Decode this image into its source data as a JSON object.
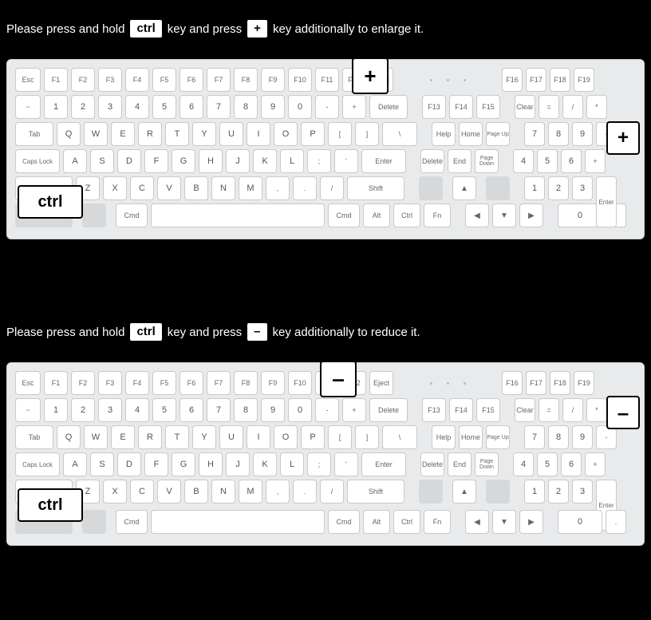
{
  "enlarge": {
    "instruction_pre": "Please press and hold",
    "ctrl_label": "ctrl",
    "instruction_mid": "key and press",
    "op_label": "+",
    "instruction_post": "key additionally to enlarge it.",
    "callout_ctrl": "ctrl",
    "callout_plus_main": "+",
    "callout_plus_num": "+"
  },
  "reduce": {
    "instruction_pre": "Please press and hold",
    "ctrl_label": "ctrl",
    "instruction_mid": "key and press",
    "op_label": "–",
    "instruction_post": "key additionally to reduce it.",
    "callout_ctrl": "ctrl",
    "callout_minus_main": "–",
    "callout_minus_num": "–"
  },
  "keys": {
    "esc": "Esc",
    "f1": "F1",
    "f2": "F2",
    "f3": "F3",
    "f4": "F4",
    "f5": "F5",
    "f6": "F6",
    "f7": "F7",
    "f8": "F8",
    "f9": "F9",
    "f10": "F10",
    "f11": "F11",
    "f12": "F12",
    "eject": "Eject",
    "f13": "F13",
    "f14": "F14",
    "f15": "F15",
    "f16": "F16",
    "f17": "F17",
    "f18": "F18",
    "f19": "F19",
    "tilde": "~",
    "n1": "1",
    "n2": "2",
    "n3": "3",
    "n4": "4",
    "n5": "5",
    "n6": "6",
    "n7": "7",
    "n8": "8",
    "n9": "9",
    "n0": "0",
    "minus": "-",
    "plus": "+",
    "delete": "Delete",
    "tab": "Tab",
    "q": "Q",
    "w": "W",
    "e": "E",
    "r": "R",
    "t": "T",
    "y": "Y",
    "u": "U",
    "i": "I",
    "o": "O",
    "p": "P",
    "lb": "[",
    "rb": "]",
    "bslash": "\\",
    "caps": "Caps Lock",
    "a": "A",
    "s": "S",
    "d": "D",
    "f": "F",
    "g": "G",
    "h": "H",
    "j": "J",
    "k": "K",
    "l": "L",
    "semi": ";",
    "apos": "'",
    "enter": "Enter",
    "shift": "Shift",
    "z": "Z",
    "x": "X",
    "c": "C",
    "v": "V",
    "b": "B",
    "n": "N",
    "m": "M",
    "comma": ",",
    "dot": ".",
    "slash": "/",
    "cmd": "Cmd",
    "alt": "Alt",
    "ctrl": "Ctrl",
    "fn": "Fn",
    "help": "Help",
    "home": "Home",
    "pgup": "Page Up",
    "del2": "Delete",
    "end": "End",
    "pgdn": "Page Down",
    "clear": "Clear",
    "eq": "=",
    "div": "/",
    "mul": "*",
    "np7": "7",
    "np8": "8",
    "np9": "9",
    "npMinus": "-",
    "np4": "4",
    "np5": "5",
    "np6": "6",
    "npPlus": "+",
    "np1": "1",
    "np2": "2",
    "np3": "3",
    "np0": "0",
    "npDot": ".",
    "npEnter": "Enter",
    "up": "▲",
    "down": "▼",
    "left": "◀",
    "right": "▶"
  }
}
